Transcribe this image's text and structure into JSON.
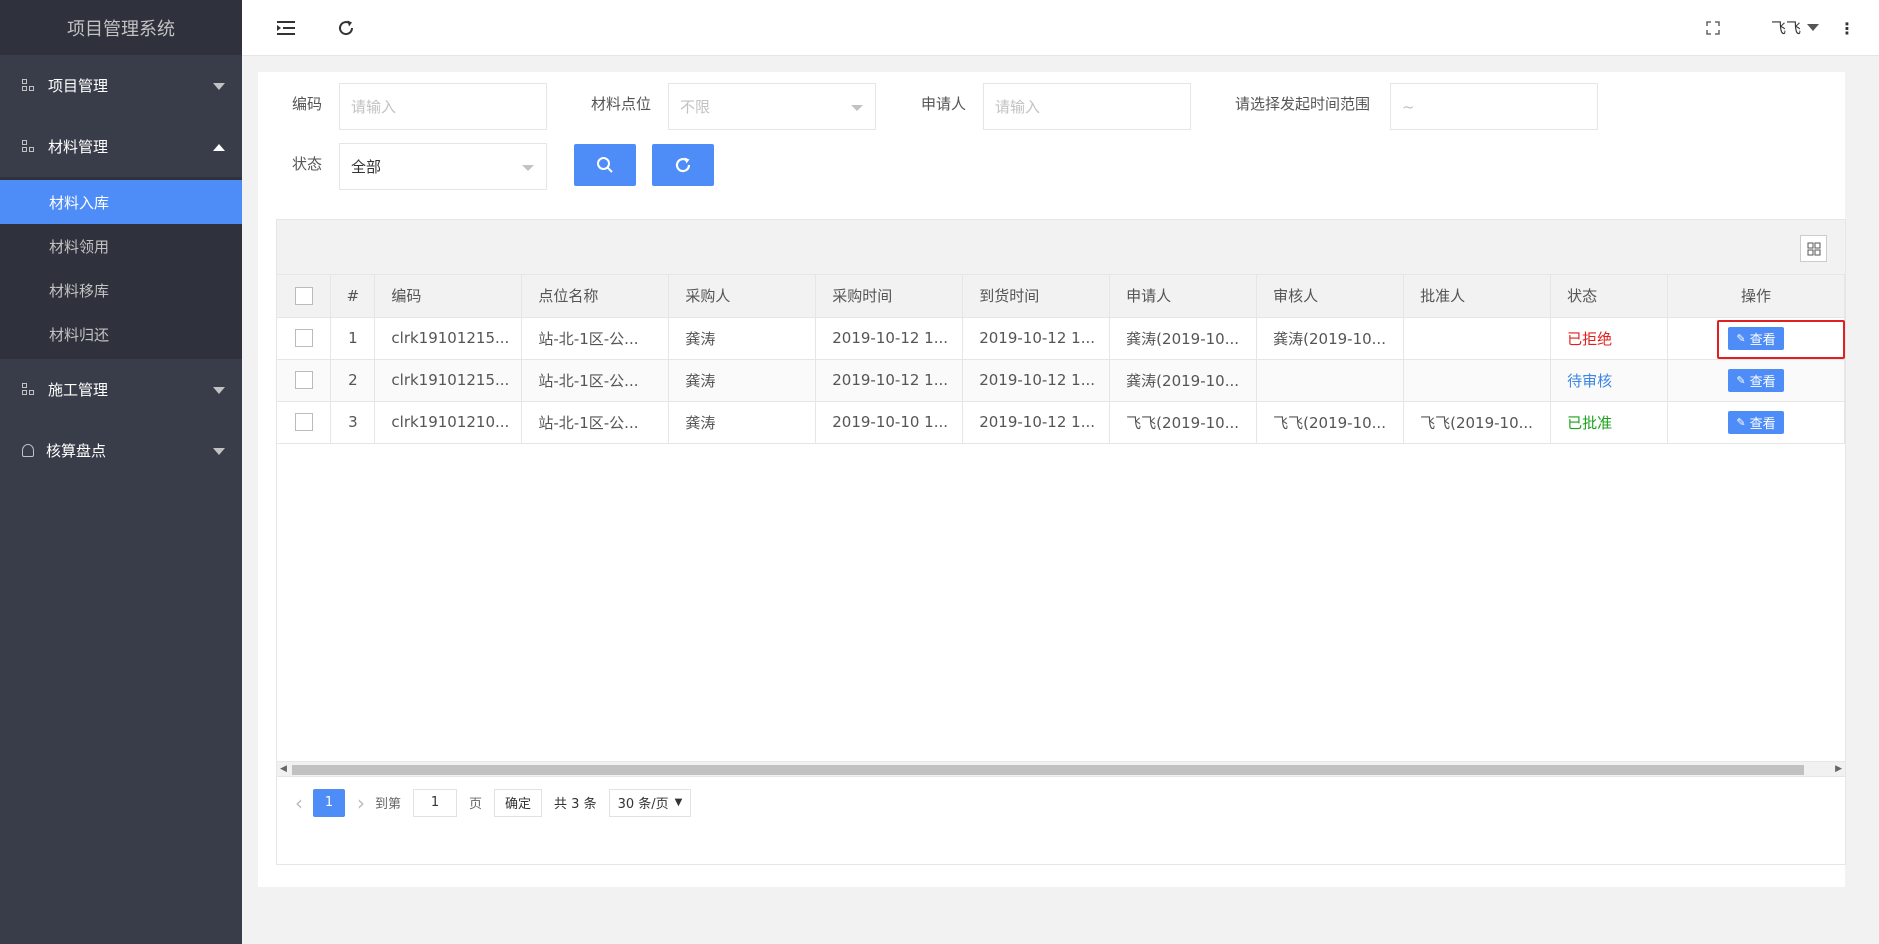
{
  "app_title": "项目管理系统",
  "sidebar": {
    "groups": [
      {
        "label": "项目管理",
        "expanded": false
      },
      {
        "label": "材料管理",
        "expanded": true,
        "items": [
          "材料入库",
          "材料领用",
          "材料移库",
          "材料归还"
        ],
        "active": "材料入库"
      },
      {
        "label": "施工管理",
        "expanded": false
      },
      {
        "label": "核算盘点",
        "expanded": false
      }
    ]
  },
  "topbar": {
    "menu_icon": "menu-fold-icon",
    "refresh_icon": "refresh-icon",
    "fullscreen_icon": "fullscreen-icon",
    "user": "飞飞",
    "more_icon": "more-vertical-icon"
  },
  "filters": {
    "code_label": "编码",
    "code_placeholder": "请输入",
    "location_label": "材料点位",
    "location_value": "不限",
    "applicant_label": "申请人",
    "applicant_placeholder": "请输入",
    "range_label": "请选择发起时间范围",
    "range_value": "~",
    "status_label": "状态",
    "status_value": "全部",
    "search_icon": "search-icon",
    "reset_icon": "refresh-icon"
  },
  "table": {
    "columns": [
      "#",
      "编码",
      "点位名称",
      "采购人",
      "采购时间",
      "到货时间",
      "申请人",
      "审核人",
      "批准人",
      "状态",
      "操作"
    ],
    "rows": [
      {
        "idx": "1",
        "code": "clrk19101215...",
        "location": "站-北-1区-公...",
        "buyer": "龚涛",
        "buy_time": "2019-10-12 1...",
        "arrive_time": "2019-10-12 1...",
        "applicant": "龚涛(2019-10...",
        "reviewer": "龚涛(2019-10...",
        "approver": "",
        "status": "已拒绝",
        "status_color": "#e02020",
        "action": "查看"
      },
      {
        "idx": "2",
        "code": "clrk19101215...",
        "location": "站-北-1区-公...",
        "buyer": "龚涛",
        "buy_time": "2019-10-12 1...",
        "arrive_time": "2019-10-12 1...",
        "applicant": "龚涛(2019-10...",
        "reviewer": "",
        "approver": "",
        "status": "待审核",
        "status_color": "#3b86e6",
        "action": "查看"
      },
      {
        "idx": "3",
        "code": "clrk19101210...",
        "location": "站-北-1区-公...",
        "buyer": "龚涛",
        "buy_time": "2019-10-10 1...",
        "arrive_time": "2019-10-12 1...",
        "applicant": "飞飞(2019-10...",
        "reviewer": "飞飞(2019-10...",
        "approver": "飞飞(2019-10...",
        "status": "已批准",
        "status_color": "#19a319",
        "action": "查看"
      }
    ]
  },
  "pager": {
    "current_page": "1",
    "goto_label": "到第",
    "goto_value": "1",
    "page_unit": "页",
    "confirm": "确定",
    "total": "共 3 条",
    "page_size": "30 条/页"
  },
  "colors": {
    "accent": "#4e8cf7",
    "sidebar": "#393d49",
    "highlight": "#e02020"
  }
}
